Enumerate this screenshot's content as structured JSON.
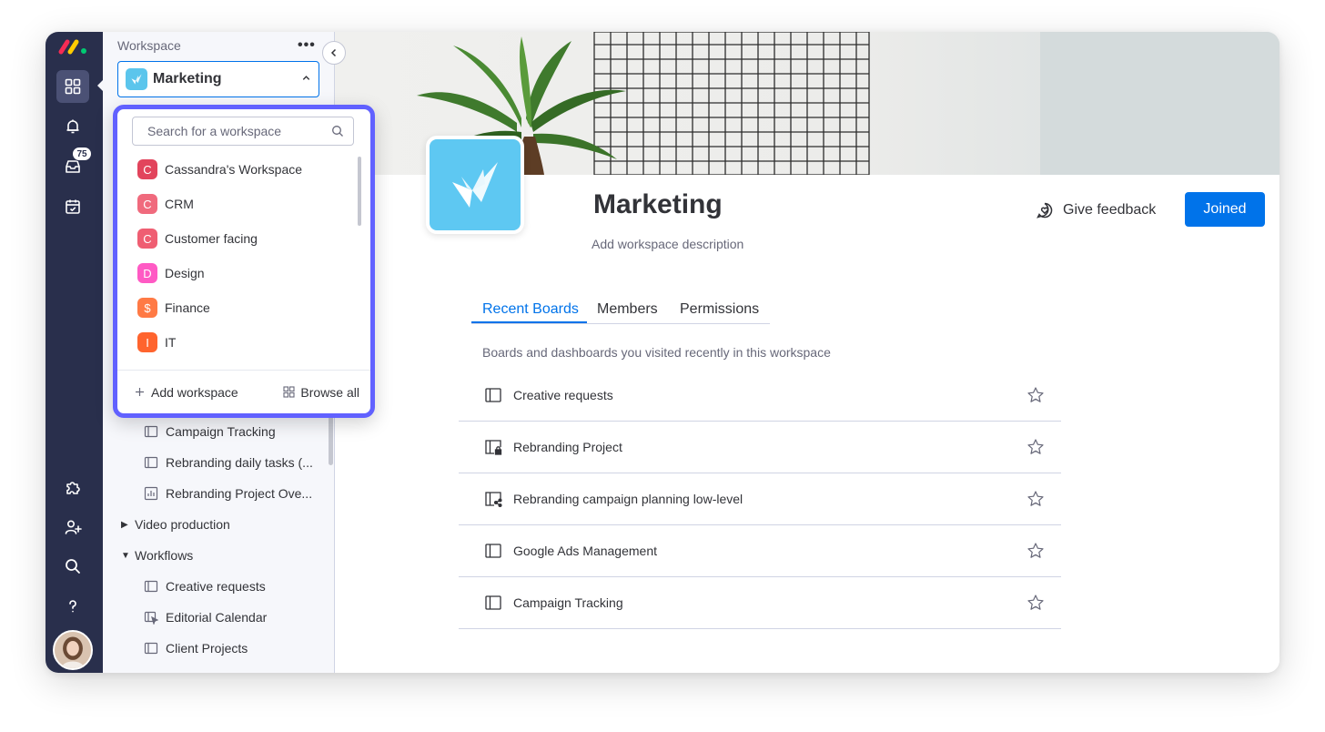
{
  "rail": {
    "badge_count": "75",
    "icons": [
      "monday-logo",
      "grid-icon",
      "bell-icon",
      "inbox-icon",
      "calendar-check-icon",
      "puzzle-icon",
      "add-user-icon",
      "search-icon",
      "help-icon"
    ]
  },
  "sidebar": {
    "label": "Workspace",
    "more": "•••",
    "selected_workspace": "Marketing",
    "tree": [
      {
        "label": "Campaign Tracking",
        "type": "board"
      },
      {
        "label": "Rebranding daily tasks (...",
        "type": "board"
      },
      {
        "label": "Rebranding Project Ove...",
        "type": "dashboard"
      },
      {
        "label": "Video production",
        "type": "folder-collapsed"
      },
      {
        "label": "Workflows",
        "type": "folder-expanded"
      },
      {
        "label": "Creative requests",
        "type": "board"
      },
      {
        "label": "Editorial Calendar",
        "type": "board-shareable"
      },
      {
        "label": "Client Projects",
        "type": "board"
      }
    ]
  },
  "dropdown": {
    "search_placeholder": "Search for a workspace",
    "items": [
      {
        "letter": "C",
        "label": "Cassandra's Workspace",
        "color": "#e2445c"
      },
      {
        "letter": "C",
        "label": "CRM",
        "color": "#f06a7d"
      },
      {
        "letter": "C",
        "label": "Customer facing",
        "color": "#ef5e72"
      },
      {
        "letter": "D",
        "label": "Design",
        "color": "#ff5ac4"
      },
      {
        "letter": "$",
        "label": "Finance",
        "color": "#ff7a45"
      },
      {
        "letter": "I",
        "label": "IT",
        "color": "#ff642e"
      }
    ],
    "add_label": "Add workspace",
    "browse_label": "Browse all"
  },
  "main": {
    "title": "Marketing",
    "description": "Add workspace description",
    "feedback_label": "Give feedback",
    "joined_label": "Joined",
    "tabs": [
      {
        "label": "Recent Boards",
        "active": true
      },
      {
        "label": "Members",
        "active": false
      },
      {
        "label": "Permissions",
        "active": false
      }
    ],
    "subtitle": "Boards and dashboards you visited recently in this workspace",
    "boards": [
      {
        "label": "Creative requests",
        "icon": "board-icon"
      },
      {
        "label": "Rebranding Project",
        "icon": "private-board-icon"
      },
      {
        "label": "Rebranding campaign planning low-level",
        "icon": "shareable-board-icon"
      },
      {
        "label": "Google Ads Management",
        "icon": "board-icon"
      },
      {
        "label": "Campaign Tracking",
        "icon": "board-icon"
      }
    ]
  },
  "colors": {
    "accent": "#0073ea",
    "rail": "#292f4c",
    "popover_border": "#6161ff",
    "workspace_icon": "#5ec8f2"
  }
}
